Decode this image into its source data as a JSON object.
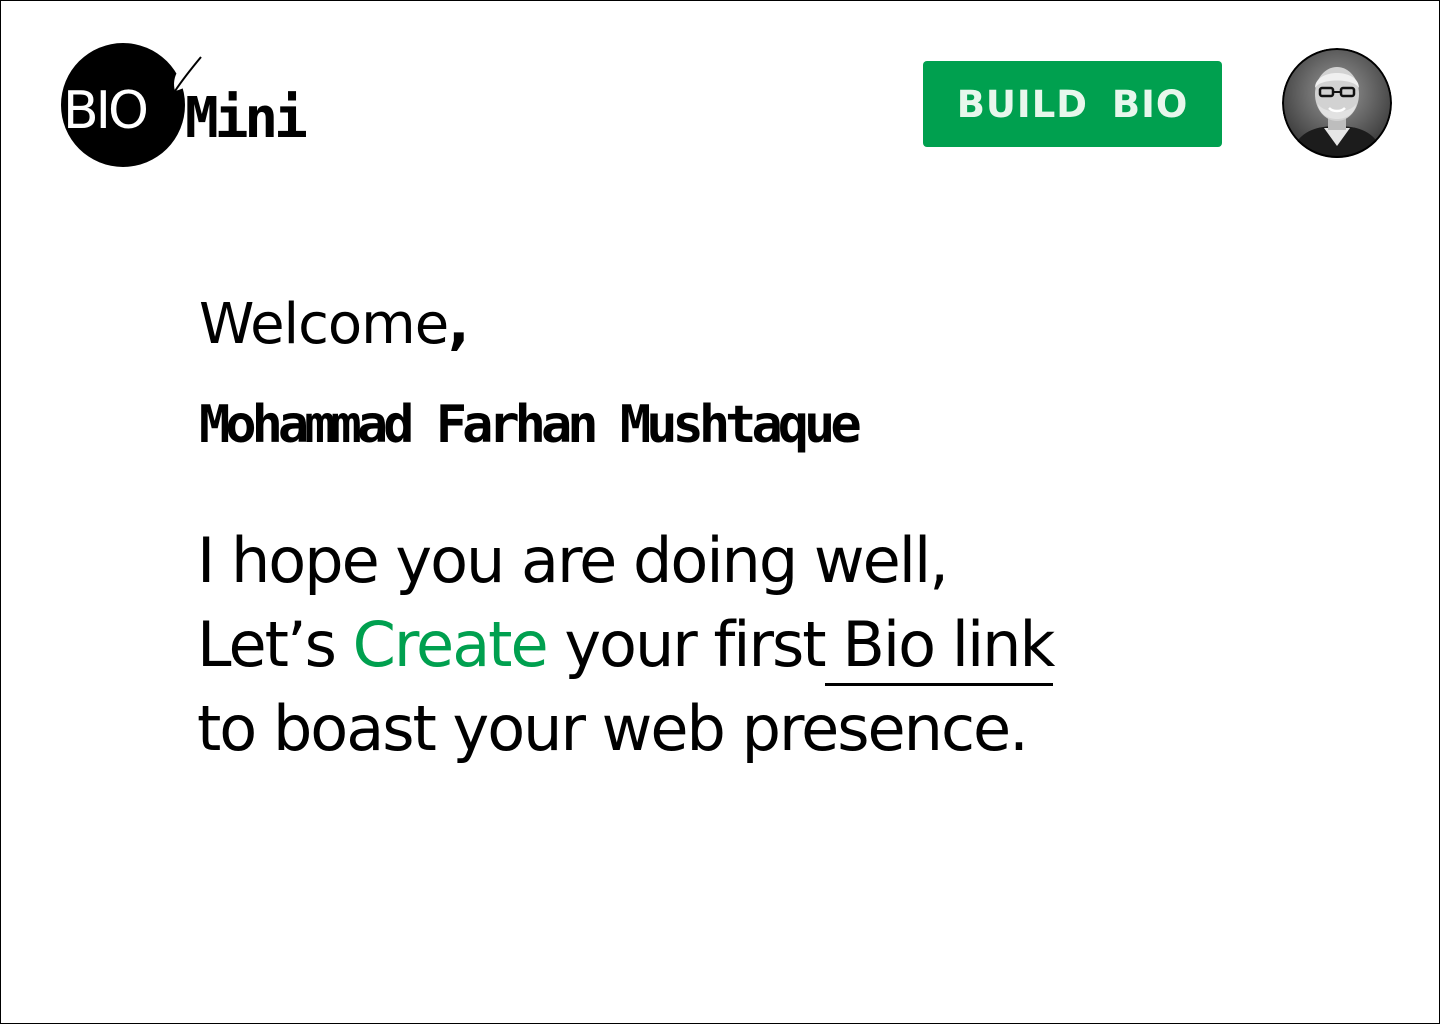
{
  "header": {
    "logo": {
      "bio_text": "BI",
      "bio_o": "O",
      "mini_text": "Mini"
    },
    "build_button_label": "BUILD BIO",
    "avatar_icon": "profile-photo"
  },
  "main": {
    "welcome_text": "Welcome",
    "welcome_punct": ",",
    "user_name": "Mohammad Farhan Mushtaque",
    "message": {
      "line1": "I hope you are doing well,",
      "line2_before": "Let’s ",
      "line2_highlight": "Create",
      "line2_middle": " your first",
      "line2_link": " Bio link",
      "line3": "to boast your web presence."
    }
  },
  "colors": {
    "accent": "#00a04f",
    "button_text": "#e7f7ec",
    "text": "#000000",
    "background": "#ffffff"
  }
}
